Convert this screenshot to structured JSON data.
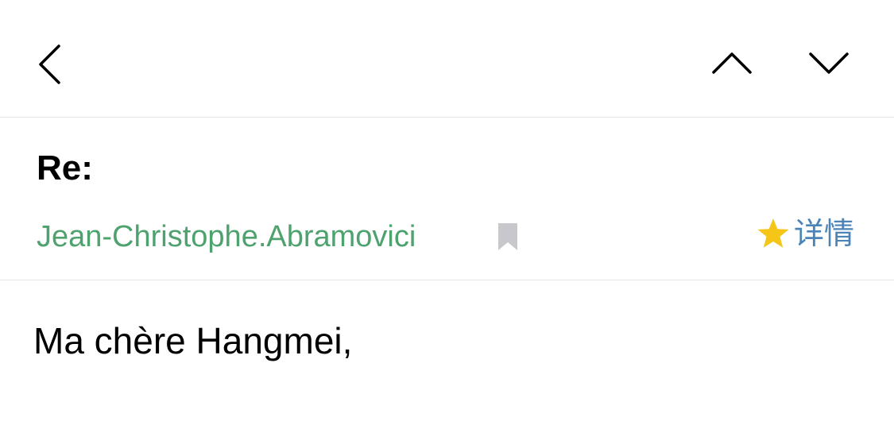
{
  "nav": {
    "back_icon": "chevron-left-icon",
    "prev_icon": "chevron-up-icon",
    "next_icon": "chevron-down-icon"
  },
  "message": {
    "subject": "Re:",
    "sender": "Jean-Christophe.Abramovici",
    "details_label": "详情",
    "body_greeting": "Ma chère Hangmei,"
  },
  "colors": {
    "sender": "#4ea26e",
    "details": "#4a84b8",
    "star": "#f5c518",
    "bookmark": "#c8c8cc"
  }
}
